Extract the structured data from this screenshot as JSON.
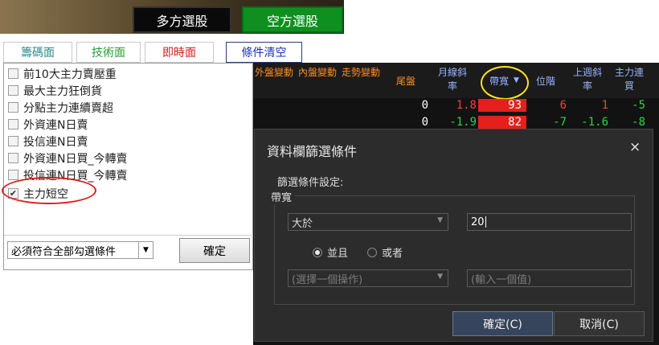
{
  "top_buttons": {
    "long": "多方選股",
    "short": "空方選股"
  },
  "tabs": [
    {
      "label": "籌碼面"
    },
    {
      "label": "技術面"
    },
    {
      "label": "即時面"
    }
  ],
  "clear_button": "條件清空",
  "filters": [
    {
      "label": "前10大主力賣壓重",
      "checked": false
    },
    {
      "label": "最大主力狂倒貨",
      "checked": false
    },
    {
      "label": "分點主力連續賣超",
      "checked": false
    },
    {
      "label": "外資連N日賣",
      "checked": false
    },
    {
      "label": "投信連N日賣",
      "checked": false
    },
    {
      "label": "外資連N日買_今轉賣",
      "checked": false
    },
    {
      "label": "投信連N日買_今轉賣",
      "checked": false
    },
    {
      "label": "主力短空",
      "checked": true
    }
  ],
  "match_select": "必須符合全部勾選條件",
  "confirm_label": "確定",
  "grid": {
    "headers": [
      {
        "label": "外盤變動",
        "color": "orange"
      },
      {
        "label": "內盤變動",
        "color": "orange"
      },
      {
        "label": "走勢變動",
        "color": "orange"
      },
      {
        "label": "尾盤",
        "color": "orange"
      },
      {
        "label": "月線斜率",
        "color": "blue"
      },
      {
        "label": "帶寬",
        "color": "blue"
      },
      {
        "label": "位階",
        "color": "blue"
      },
      {
        "label": "上週斜率",
        "color": "blue"
      },
      {
        "label": "主力連買",
        "color": "blue"
      }
    ],
    "rows": [
      {
        "tail": "0",
        "slope": "1.8",
        "bandwidth": "93",
        "level": "6",
        "wslope": "1",
        "main": "-5"
      },
      {
        "tail": "0",
        "slope": "-1.9",
        "bandwidth": "82",
        "level": "-7",
        "wslope": "-1.6",
        "main": "-8"
      }
    ]
  },
  "dialog": {
    "title": "資料欄篩選條件",
    "close": "×",
    "settings_label": "篩選條件設定:",
    "field": "帶寬",
    "operator": "大於",
    "value": "20",
    "radio_and": "並且",
    "radio_or": "或者",
    "operator_placeholder": "(選擇一個操作)",
    "value_placeholder": "(輸入一個值)",
    "ok": "確定(C)",
    "cancel": "取消(C)"
  }
}
